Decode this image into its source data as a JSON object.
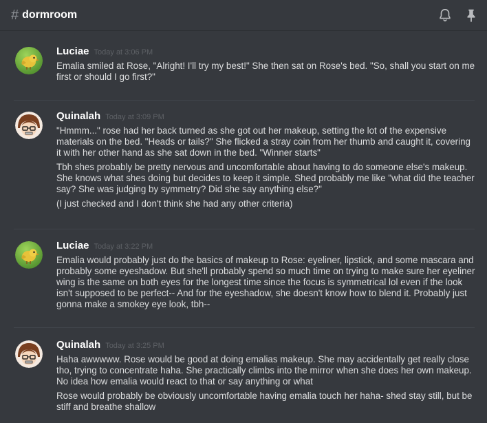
{
  "channel": {
    "name": "dormroom"
  },
  "header_icons": [
    "bell-icon",
    "pin-icon"
  ],
  "colors": {
    "background": "#36393e",
    "username": "#ffffff",
    "timestamp": "#5e6166",
    "text": "#dcddde"
  },
  "groups": [
    {
      "username": "Luciae",
      "timestamp": "Today at 3:06 PM",
      "avatar": "bird-avatar",
      "messages": [
        "Emalia smiled at Rose, \"Alright! I'll try my best!\" She then sat on Rose's bed. \"So, shall you start on me first or should I go first?\""
      ]
    },
    {
      "username": "Quinalah",
      "timestamp": "Today at 3:09 PM",
      "avatar": "glasses-girl-avatar",
      "messages": [
        "\"Hmmm...\" rose had her back turned as she got out her makeup, setting the lot of the expensive materials on the bed. \"Heads or tails?\" She flicked a stray coin from her thumb and caught it, covering it with her other hand as she sat down in the bed. \"Winner starts\"",
        "Tbh shes probably be pretty nervous and uncomfortable about having to do someone else's makeup. She knows what shes doing but decides to keep it simple. Shed probably me like \"what did the teacher say? She was judging by symmetry? Did she say anything else?\"",
        "(I just checked and I don't think she had any other criteria)"
      ]
    },
    {
      "username": "Luciae",
      "timestamp": "Today at 3:22 PM",
      "avatar": "bird-avatar",
      "messages": [
        "Emalia would probably just do the basics of makeup to Rose: eyeliner, lipstick, and some mascara and probably some eyeshadow. But she'll probably spend so much time on trying to make sure her eyeliner wing is the same on both eyes for the longest time since the focus is symmetrical lol even if the look isn't supposed to be perfect-- And for the eyeshadow, she doesn't know how to blend it. Probably just gonna make a smokey eye look, tbh--"
      ]
    },
    {
      "username": "Quinalah",
      "timestamp": "Today at 3:25 PM",
      "avatar": "glasses-girl-avatar",
      "messages": [
        "Haha awwwww. Rose would be good at doing emalias makeup. She may accidentally get really close tho, trying to concentrate haha. She practically climbs into the mirror when she does her own makeup. No idea how emalia would react to that or say anything or what",
        "Rose would probably be obviously uncomfortable having emalia touch her haha- shed stay still, but be stiff and breathe shallow"
      ]
    }
  ]
}
